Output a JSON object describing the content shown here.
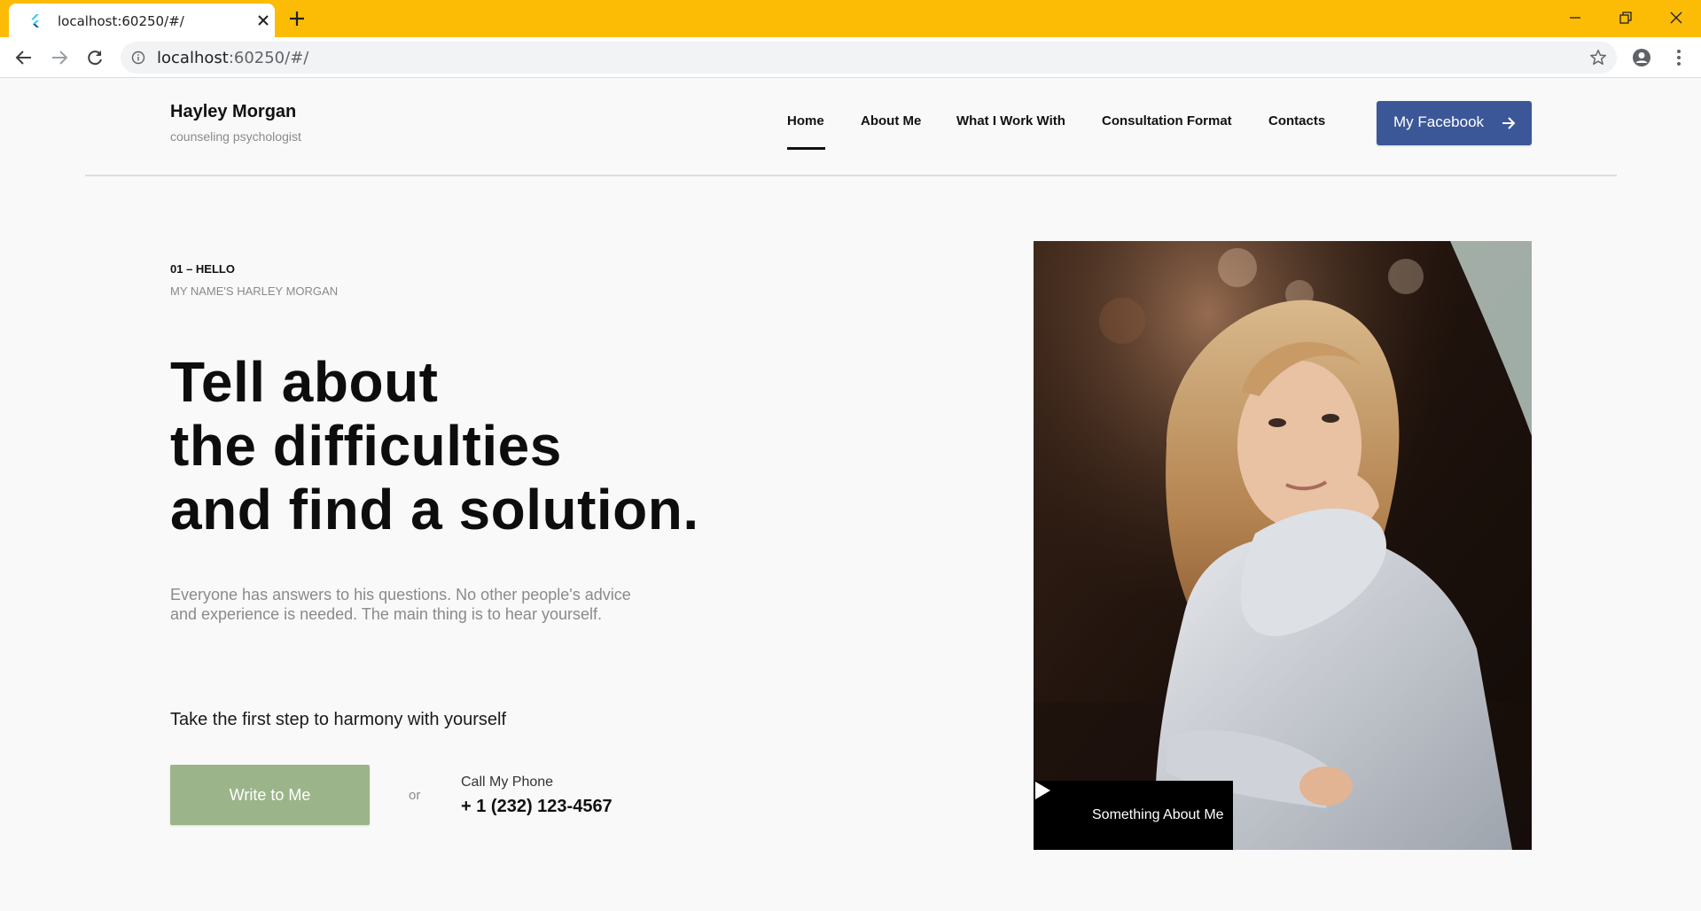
{
  "browser": {
    "tab_title": "localhost:60250/#/",
    "url_host": "localhost",
    "url_rest": ":60250/#/"
  },
  "header": {
    "brand_name": "Hayley Morgan",
    "brand_sub": "counseling psychologist",
    "nav": [
      {
        "label": "Home",
        "active": true
      },
      {
        "label": "About Me"
      },
      {
        "label": "What I Work With"
      },
      {
        "label": "Consultation Format"
      },
      {
        "label": "Contacts"
      }
    ],
    "facebook_label": "My Facebook"
  },
  "hero": {
    "eyebrow": "01 – HELLO",
    "intro": "MY NAME'S HARLEY MORGAN",
    "headline": [
      "Tell about",
      "the difficulties",
      "and find a solution."
    ],
    "lead": "Everyone has answers to his questions. No other people's advice and experience is needed. The main thing is to hear yourself.",
    "cta_heading": "Take the first step to harmony with yourself",
    "write_button": "Write to Me",
    "or": "or",
    "call_label": "Call My Phone",
    "phone": "+ 1 (232) 123-4567",
    "video_label": "Something About Me"
  },
  "colors": {
    "tabbar": "#fcbc05",
    "facebook": "#3b5797",
    "write_button": "#9cb48a"
  }
}
